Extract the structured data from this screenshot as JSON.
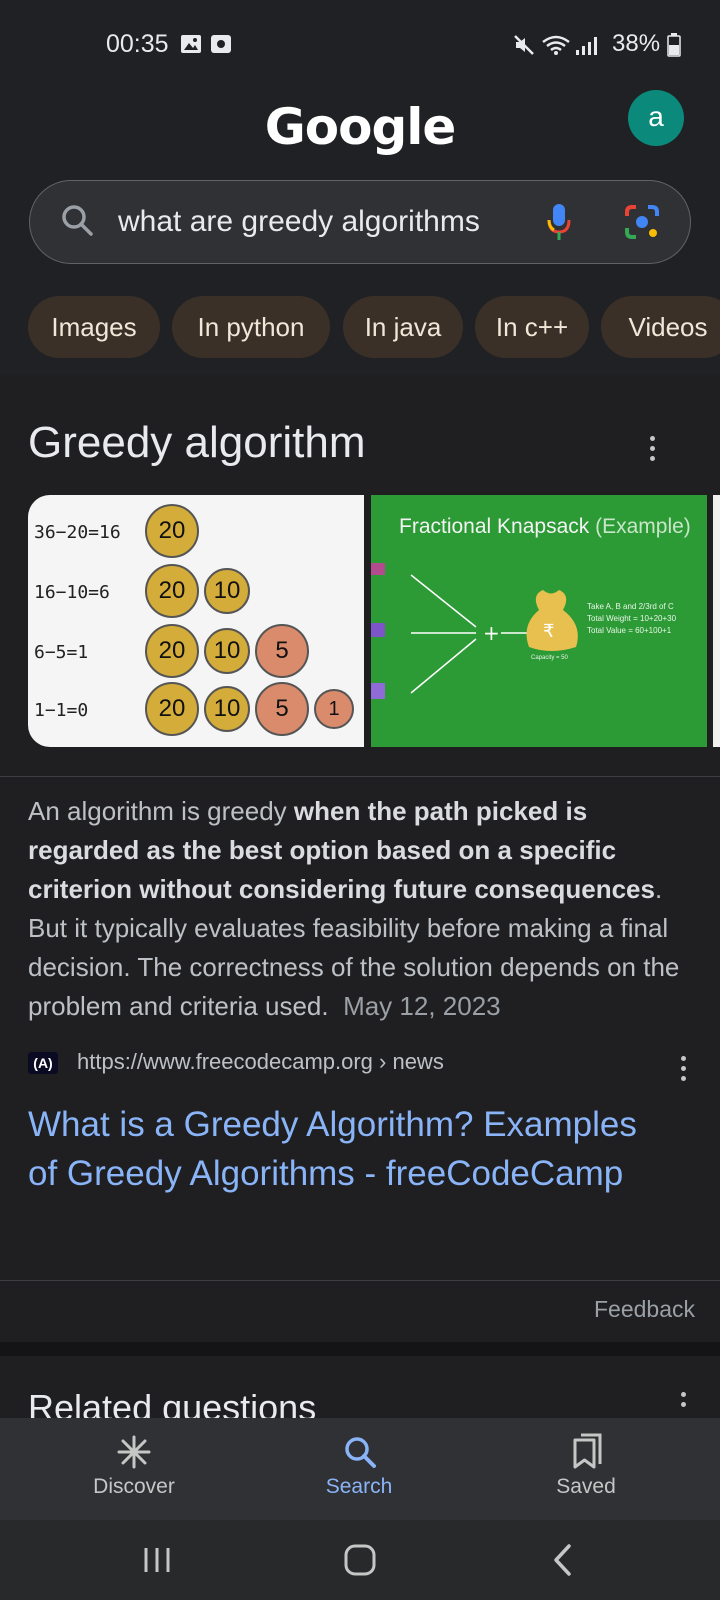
{
  "status_bar": {
    "time": "00:35",
    "battery": "38%"
  },
  "header": {
    "logo": "Google",
    "avatar_letter": "a",
    "search_query": "what are greedy algorithms"
  },
  "chips": [
    "Images",
    "In python",
    "In java",
    "In c++",
    "Videos"
  ],
  "knowledge_panel": {
    "title": "Greedy algorithm",
    "image1": {
      "rows": [
        {
          "eq": "36−20=16",
          "coins": [
            "20"
          ]
        },
        {
          "eq": "16−10=6",
          "coins": [
            "20",
            "10"
          ]
        },
        {
          "eq": "6−5=1",
          "coins": [
            "20",
            "10",
            "5"
          ]
        },
        {
          "eq": "1−1=0",
          "coins": [
            "20",
            "10",
            "5",
            "1"
          ]
        }
      ]
    },
    "image2": {
      "title": "Fractional Knapsack",
      "title_suffix": "(Example)",
      "lines": [
        "Take A, B and 2/3rd of C",
        "Total Weight = 10+20+30",
        "Total Value   = 60+100+1"
      ],
      "capacity": "Capacity = 50"
    }
  },
  "snippet": {
    "pre": "An algorithm is greedy ",
    "bold": "when the path picked is regarded as the best option based on a specific criterion without considering future consequences",
    "post": ". But it typically evaluates feasibility before making a final decision. The correctness of the solution depends on the problem and criteria used.",
    "date": "May 12, 2023"
  },
  "source": {
    "icon_text": "(A)",
    "url": "https://www.freecodecamp.org › news",
    "link_title": "What is a Greedy Algorithm? Examples of Greedy Algorithms - freeCodeCamp"
  },
  "feedback": "Feedback",
  "related_title": "Related questions",
  "bottom_nav": {
    "discover": "Discover",
    "search": "Search",
    "saved": "Saved"
  },
  "colors": {
    "accent": "#8ab4f8",
    "chip_bg": "#3a3027",
    "coin_gold": "#d4ac3a",
    "coin_red": "#d98b6c",
    "knapsack_green": "#2c9a35"
  }
}
